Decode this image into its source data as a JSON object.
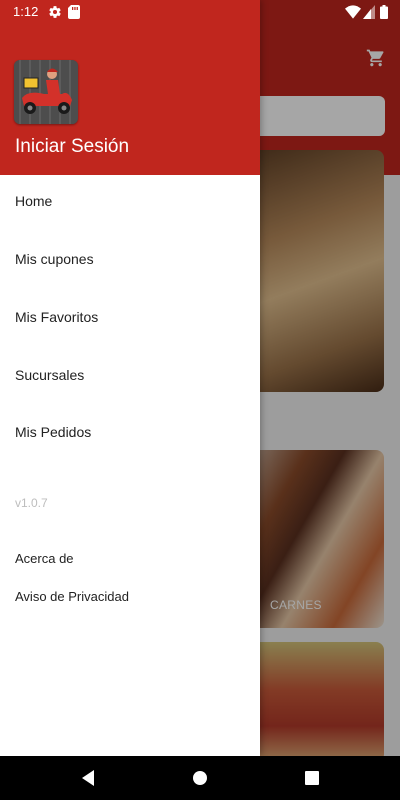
{
  "status": {
    "time": "1:12"
  },
  "drawer": {
    "header_title": "Iniciar Sesión",
    "menu": [
      {
        "label": "Home"
      },
      {
        "label": "Mis cupones"
      },
      {
        "label": "Mis Favoritos"
      },
      {
        "label": "Sucursales"
      },
      {
        "label": "Mis Pedidos"
      }
    ],
    "version": "v1.0.7",
    "footer": [
      {
        "label": "Acerca de"
      },
      {
        "label": "Aviso de Privacidad"
      }
    ]
  },
  "background": {
    "card_label": "CARNES"
  },
  "colors": {
    "brand_red": "#c0261e"
  }
}
